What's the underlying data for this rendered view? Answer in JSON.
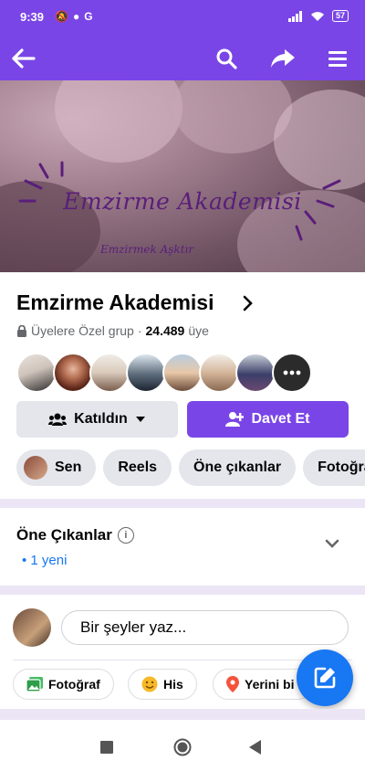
{
  "status_bar": {
    "time": "9:39",
    "battery": "57"
  },
  "app_bar": {
    "back_icon": "arrow-left-icon",
    "search_icon": "search-icon",
    "share_icon": "share-icon",
    "menu_icon": "hamburger-menu-icon"
  },
  "cover": {
    "title": "Emzirme Akademisi",
    "subtitle": "Emzirmek Aşktır"
  },
  "group": {
    "name": "Emzirme Akademisi",
    "privacy": "Üyelere Özel grup",
    "separator": "·",
    "member_count": "24.489",
    "member_suffix": "üye"
  },
  "actions": {
    "joined_label": "Katıldın",
    "invite_label": "Davet Et"
  },
  "tabs": [
    {
      "label": "Sen"
    },
    {
      "label": "Reels"
    },
    {
      "label": "Öne çıkanlar"
    },
    {
      "label": "Fotoğrafla"
    }
  ],
  "highlights": {
    "title": "Öne Çıkanlar",
    "new_label": "• 1 yeni"
  },
  "composer": {
    "placeholder": "Bir şeyler yaz..."
  },
  "quick_actions": {
    "photo": "Fotoğraf",
    "feeling": "His",
    "location": "Yerini bi"
  },
  "colors": {
    "brand": "#7a45e6",
    "link": "#1877f2",
    "fab": "#1877f2"
  }
}
